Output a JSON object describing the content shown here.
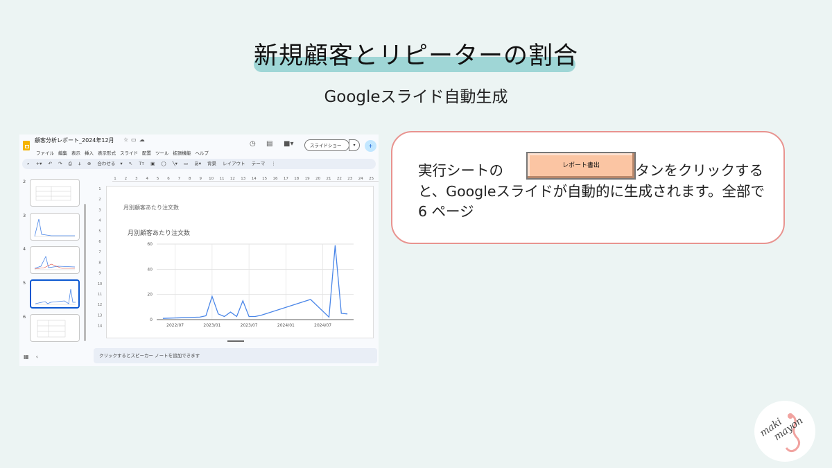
{
  "slide": {
    "title": "新規顧客とリピーターの割合",
    "subtitle": "Googleスライド自動生成",
    "highlight_color": "#9fd6d6"
  },
  "screenshot": {
    "doc_title": "顧客分析レポート_2024年12月",
    "menu": [
      "ファイル",
      "編集",
      "表示",
      "挿入",
      "表示形式",
      "スライド",
      "配置",
      "ツール",
      "拡張機能",
      "ヘルプ"
    ],
    "slideshow_label": "スライドショー",
    "toolbar": {
      "zoom_label": "合わせる",
      "background_label": "背景",
      "layout_label": "レイアウト",
      "theme_label": "テーマ"
    },
    "thumbnails": [
      {
        "num": "2",
        "selected": false
      },
      {
        "num": "3",
        "selected": false
      },
      {
        "num": "4",
        "selected": false
      },
      {
        "num": "5",
        "selected": true
      },
      {
        "num": "6",
        "selected": false
      }
    ],
    "ruler_ticks": [
      "1",
      "2",
      "3",
      "4",
      "5",
      "6",
      "7",
      "8",
      "9",
      "10",
      "11",
      "12",
      "13",
      "14",
      "15",
      "16",
      "17",
      "18",
      "19",
      "20",
      "21",
      "22",
      "23",
      "24",
      "25"
    ],
    "ruler_left_ticks": [
      "1",
      "2",
      "3",
      "4",
      "5",
      "6",
      "7",
      "8",
      "9",
      "10",
      "11",
      "12",
      "13",
      "14"
    ],
    "slide_heading": "月別顧客あたり注文数",
    "notes_placeholder": "クリックするとスピーカー ノートを追加できます",
    "chart_data": {
      "type": "line",
      "title": "月別顧客あたり注文数",
      "x_tick_labels": [
        "2022/07",
        "2023/01",
        "2023/07",
        "2024/01",
        "2024/07"
      ],
      "y_ticks": [
        0,
        20,
        40,
        60
      ],
      "ylim": [
        0,
        60
      ],
      "grid": true,
      "color": "#4a86e8",
      "x": [
        "2022/05",
        "2022/08",
        "2022/11",
        "2022/12",
        "2023/01",
        "2023/02",
        "2023/03",
        "2023/04",
        "2023/05",
        "2023/06",
        "2023/07",
        "2023/08",
        "2023/09",
        "2024/05",
        "2024/08",
        "2024/09",
        "2024/10",
        "2024/11"
      ],
      "values": [
        1,
        1.5,
        2,
        3,
        18.5,
        4.5,
        2.5,
        6,
        2.5,
        15,
        2.5,
        2.5,
        3.5,
        16,
        2,
        59,
        5,
        4.5
      ]
    }
  },
  "callout": {
    "text_before": "実行シートの",
    "button_label": "レポート書出",
    "text_after": "ボタンをクリックすると、Googleスライドが自動的に生成されます。全部で 6 ページ",
    "border_color": "#e8938f",
    "button_color": "#fbc5a3"
  },
  "logo": {
    "text": "maki mayon"
  }
}
